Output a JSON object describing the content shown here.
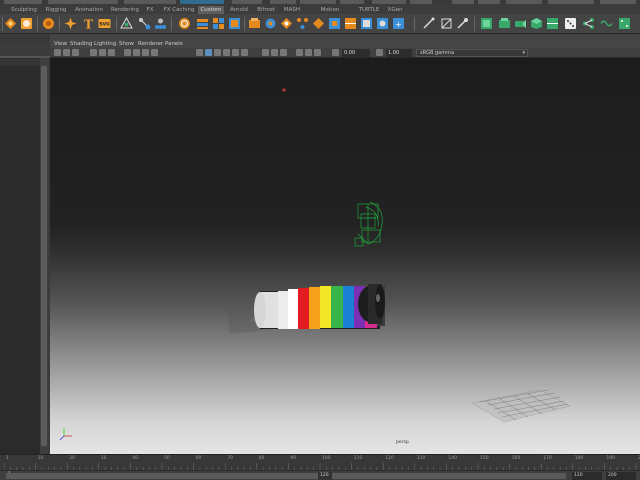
{
  "shelf_tabs": [
    {
      "label": "Sculpting",
      "active": false
    },
    {
      "label": "Rigging",
      "active": false
    },
    {
      "label": "Animation",
      "active": false
    },
    {
      "label": "Rendering",
      "active": false
    },
    {
      "label": "FX",
      "active": false
    },
    {
      "label": "FX Caching",
      "active": false
    },
    {
      "label": "Custom",
      "active": true
    },
    {
      "label": "Arnold",
      "active": false
    },
    {
      "label": "Bifrost",
      "active": false
    },
    {
      "label": "MASH",
      "active": false
    },
    {
      "label": "Motion Graphics",
      "active": false
    },
    {
      "label": "TURTLE",
      "active": false
    },
    {
      "label": "XGen",
      "active": false
    }
  ],
  "shelf_icons": [
    "orange-diamond-icon",
    "orange-sphere-icon",
    "orange-star-icon",
    "text-icon",
    "svg-icon",
    "shade-icon",
    "render-icon",
    "light-icon",
    "cycle-icon",
    "layers-icon",
    "rows-icon",
    "modules-icon",
    "box-icon",
    "deformer-icon",
    "grid-icon",
    "network-icon",
    "wand-icon",
    "brush-icon",
    "plane-icon",
    "cube-icon",
    "cube-green-icon",
    "shell-icon",
    "camera-icon",
    "dice-icon",
    "nodes-icon"
  ],
  "viewport_menu": [
    "View",
    "Shading",
    "Lighting",
    "Show",
    "Renderer",
    "Panels"
  ],
  "viewport_toolbar": {
    "exposure": "0.00",
    "gamma": "1.00",
    "color_management": "sRGB gamma"
  },
  "camera_label": "persp",
  "timeline": {
    "ticks": [
      "1",
      "10",
      "20",
      "30",
      "40",
      "50",
      "60",
      "70",
      "80",
      "90",
      "100",
      "110",
      "120",
      "130",
      "140",
      "150",
      "160",
      "170",
      "180",
      "190",
      "200"
    ],
    "start_frame": "1",
    "end_frame": "120",
    "range_end": "120",
    "max_frame": "200"
  },
  "colors": {
    "background": "#444444",
    "stripes": [
      "#ffffff",
      "#e31b23",
      "#f7a21a",
      "#f2e827",
      "#38b54a",
      "#1c7fd6",
      "#7b2fb5",
      "#d52b8c",
      "#333333"
    ]
  }
}
